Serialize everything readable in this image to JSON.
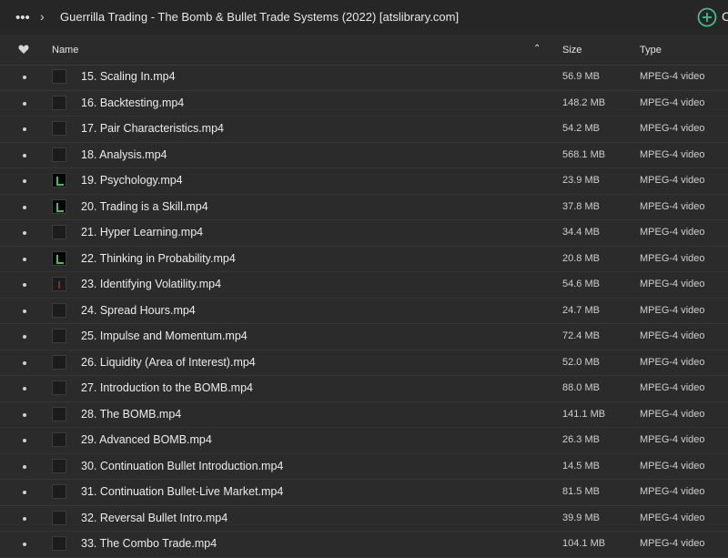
{
  "topbar": {
    "more_label": "•••",
    "chevron": "›",
    "path": "Guerrilla Trading - The Bomb & Bullet Trade Systems (2022) [atslibrary.com]",
    "add_partial": "C",
    "accent": "#3fbf8f"
  },
  "columns": {
    "name": "Name",
    "size": "Size",
    "type": "Type",
    "sort_indicator": "⌃"
  },
  "files": [
    {
      "name": "15. Scaling In.mp4",
      "size": "56.9 MB",
      "type": "MPEG-4 video",
      "thumb": "plain"
    },
    {
      "name": "16. Backtesting.mp4",
      "size": "148.2 MB",
      "type": "MPEG-4 video",
      "thumb": "plain"
    },
    {
      "name": "17. Pair Characteristics.mp4",
      "size": "54.2 MB",
      "type": "MPEG-4 video",
      "thumb": "plain"
    },
    {
      "name": "18. Analysis.mp4",
      "size": "568.1 MB",
      "type": "MPEG-4 video",
      "thumb": "plain"
    },
    {
      "name": "19. Psychology.mp4",
      "size": "23.9 MB",
      "type": "MPEG-4 video",
      "thumb": "logo"
    },
    {
      "name": "20. Trading is a Skill.mp4",
      "size": "37.8 MB",
      "type": "MPEG-4 video",
      "thumb": "logo"
    },
    {
      "name": "21. Hyper Learning.mp4",
      "size": "34.4 MB",
      "type": "MPEG-4 video",
      "thumb": "plain"
    },
    {
      "name": "22. Thinking in Probability.mp4",
      "size": "20.8 MB",
      "type": "MPEG-4 video",
      "thumb": "logo"
    },
    {
      "name": "23. Identifying Volatility.mp4",
      "size": "54.6 MB",
      "type": "MPEG-4 video",
      "thumb": "red"
    },
    {
      "name": "24. Spread Hours.mp4",
      "size": "24.7 MB",
      "type": "MPEG-4 video",
      "thumb": "plain"
    },
    {
      "name": "25. Impulse and Momentum.mp4",
      "size": "72.4 MB",
      "type": "MPEG-4 video",
      "thumb": "plain"
    },
    {
      "name": "26. Liquidity (Area of Interest).mp4",
      "size": "52.0 MB",
      "type": "MPEG-4 video",
      "thumb": "plain"
    },
    {
      "name": "27. Introduction to the BOMB.mp4",
      "size": "88.0 MB",
      "type": "MPEG-4 video",
      "thumb": "plain"
    },
    {
      "name": "28. The BOMB.mp4",
      "size": "141.1 MB",
      "type": "MPEG-4 video",
      "thumb": "plain"
    },
    {
      "name": "29. Advanced BOMB.mp4",
      "size": "26.3 MB",
      "type": "MPEG-4 video",
      "thumb": "plain"
    },
    {
      "name": "30. Continuation Bullet Introduction.mp4",
      "size": "14.5 MB",
      "type": "MPEG-4 video",
      "thumb": "plain"
    },
    {
      "name": "31. Continuation Bullet-Live Market.mp4",
      "size": "81.5 MB",
      "type": "MPEG-4 video",
      "thumb": "plain"
    },
    {
      "name": "32. Reversal Bullet Intro.mp4",
      "size": "39.9 MB",
      "type": "MPEG-4 video",
      "thumb": "plain"
    },
    {
      "name": "33. The Combo Trade.mp4",
      "size": "104.1 MB",
      "type": "MPEG-4 video",
      "thumb": "plain"
    }
  ]
}
